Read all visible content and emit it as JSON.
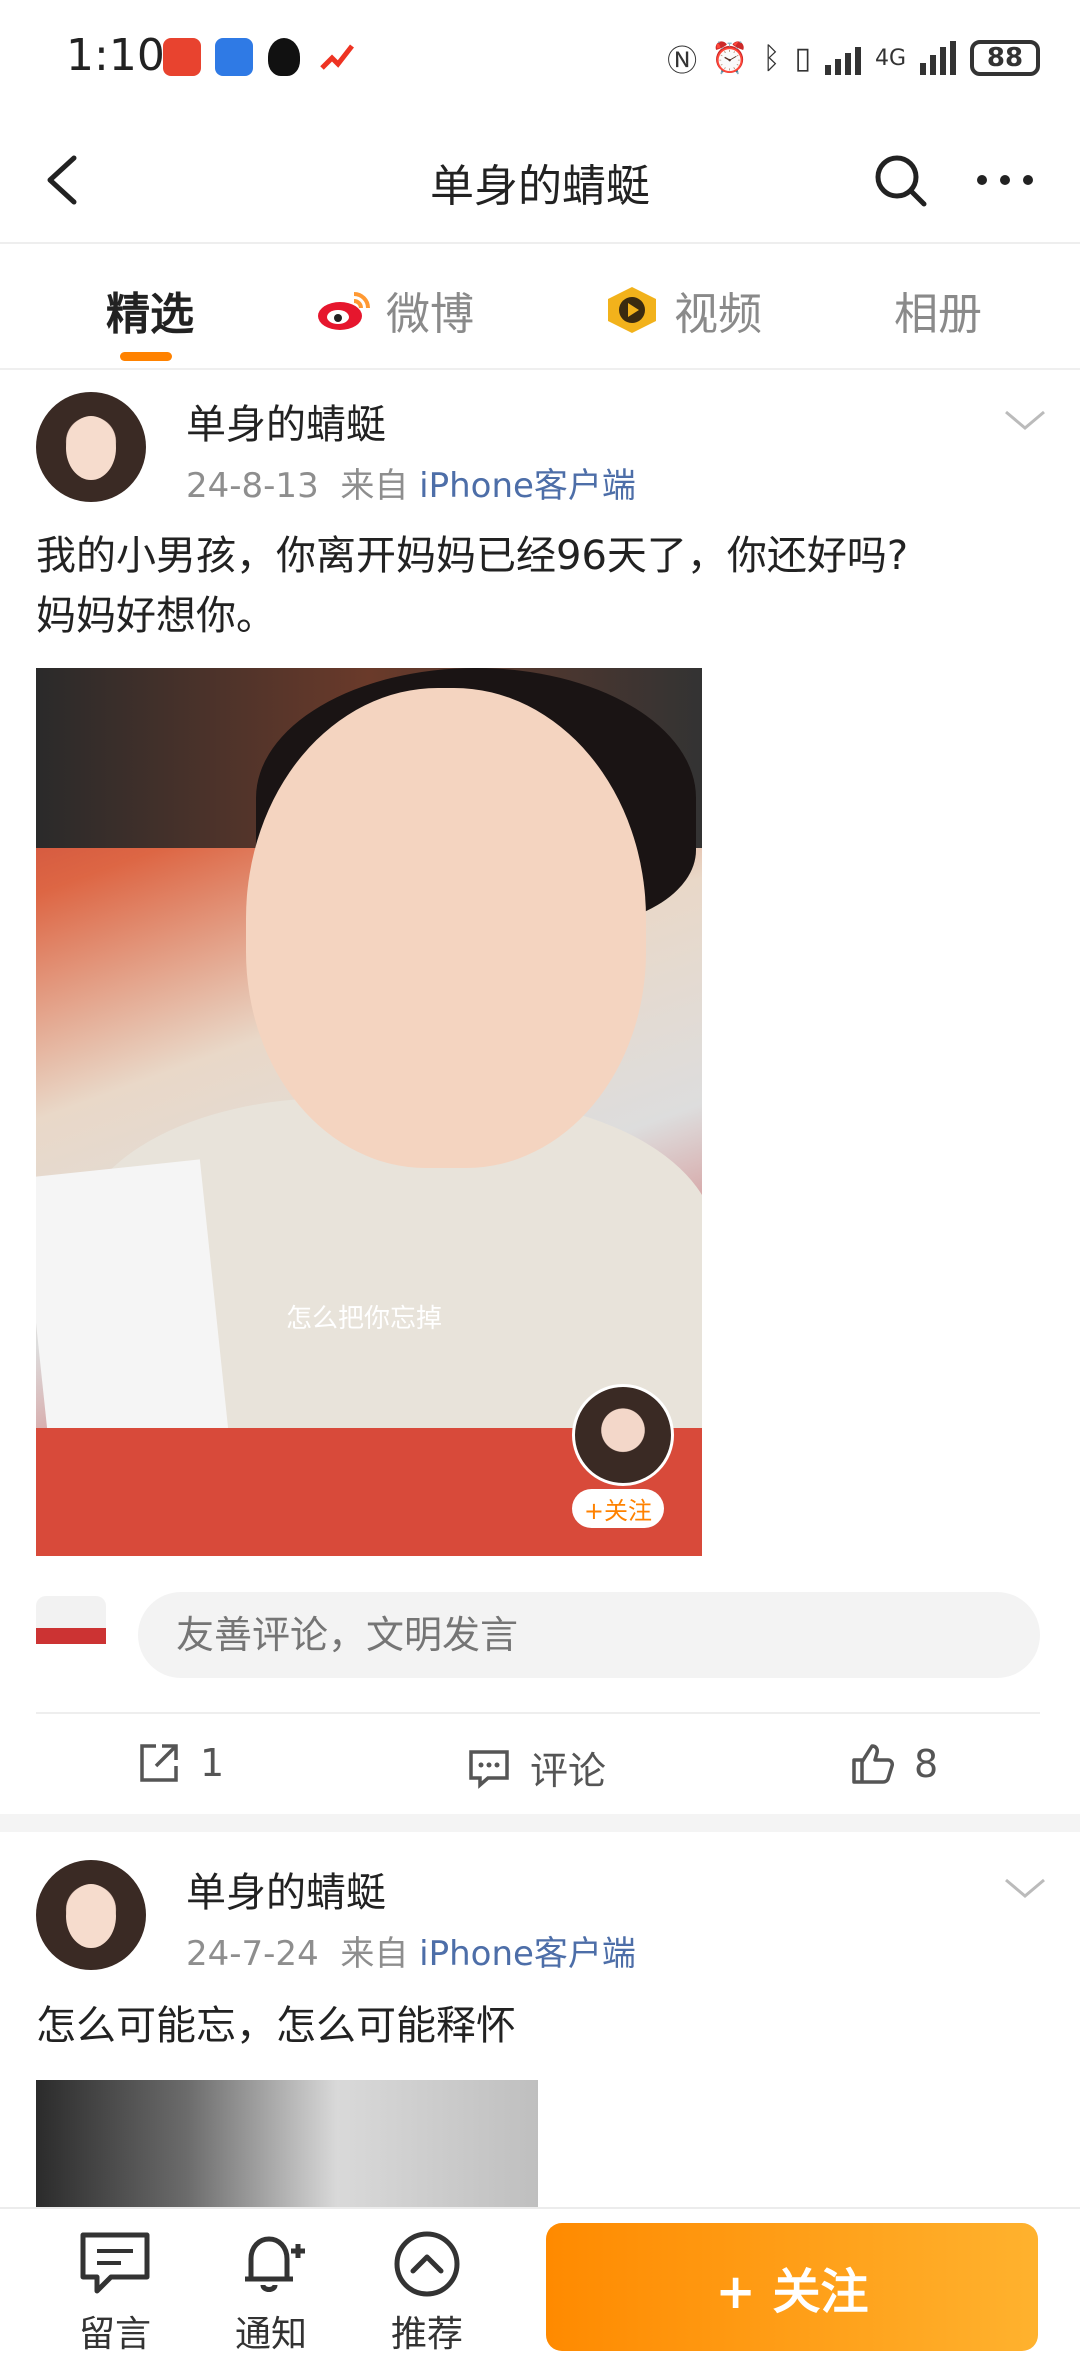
{
  "status_bar": {
    "time": "1:10",
    "battery": "88",
    "network": "4G"
  },
  "header": {
    "title": "单身的蜻蜓"
  },
  "tabs": [
    {
      "label": "精选",
      "active": true,
      "icon": "none"
    },
    {
      "label": "微博",
      "active": false,
      "icon": "weibo-logo-icon"
    },
    {
      "label": "视频",
      "active": false,
      "icon": "video-play-icon"
    },
    {
      "label": "相册",
      "active": false,
      "icon": "none"
    }
  ],
  "posts": [
    {
      "author": "单身的蜻蜓",
      "date": "24-8-13",
      "from": "来自",
      "source": "iPhone客户端",
      "text_line1": "我的小男孩，你离开妈妈已经96天了，你还好吗?",
      "text_line2": "妈妈好想你。",
      "image_caption": "怎么把你忘掉",
      "image_follow": "+关注",
      "comment_placeholder": "友善评论，文明发言",
      "repost_count": "1",
      "comment_label": "评论",
      "like_count": "8"
    },
    {
      "author": "单身的蜻蜓",
      "date": "24-7-24",
      "from": "来自",
      "source": "iPhone客户端",
      "text_line1": "怎么可能忘，怎么可能释怀"
    }
  ],
  "bottom_bar": {
    "items": [
      {
        "label": "留言",
        "icon": "message-icon"
      },
      {
        "label": "通知",
        "icon": "bell-plus-icon"
      },
      {
        "label": "推荐",
        "icon": "up-circle-icon"
      }
    ],
    "follow_label": "+ 关注"
  },
  "colors": {
    "accent": "#ff8200",
    "link": "#4d6ea8",
    "follow_gradient_start": "#ff8a00",
    "follow_gradient_end": "#ffb22e"
  }
}
